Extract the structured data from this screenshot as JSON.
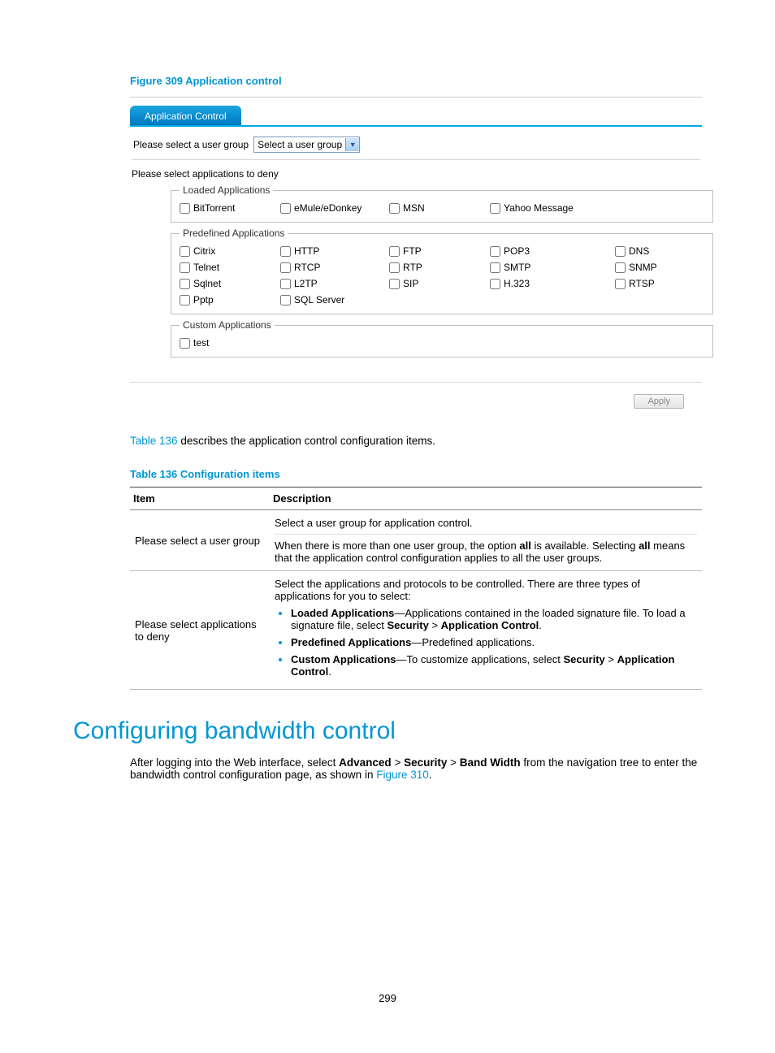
{
  "figure": {
    "caption": "Figure 309 Application control",
    "tab": "Application Control",
    "select_group_label": "Please select a user group",
    "select_group_value": "Select a user group",
    "deny_label": "Please select applications to deny",
    "fieldset_loaded": "Loaded Applications",
    "loaded": [
      "BitTorrent",
      "eMule/eDonkey",
      "MSN",
      "Yahoo Message"
    ],
    "fieldset_predefined": "Predefined Applications",
    "predefined": [
      "Citrix",
      "HTTP",
      "FTP",
      "POP3",
      "DNS",
      "Telnet",
      "RTCP",
      "RTP",
      "SMTP",
      "SNMP",
      "Sqlnet",
      "L2TP",
      "SIP",
      "H.323",
      "RTSP",
      "Pptp",
      "SQL Server"
    ],
    "fieldset_custom": "Custom Applications",
    "custom": [
      "test"
    ],
    "apply": "Apply"
  },
  "intro_before_link": "",
  "intro_link": "Table 136",
  "intro_after_link": " describes the application control configuration items.",
  "table": {
    "caption": "Table 136 Configuration items",
    "headers": [
      "Item",
      "Description"
    ],
    "row1": {
      "item": "Please select a user group",
      "desc1": "Select a user group for application control.",
      "desc2_before": "When there is more than one user group, the option ",
      "desc2_all1": "all",
      "desc2_mid": " is available. Selecting ",
      "desc2_all2": "all",
      "desc2_after": " means that the application control configuration applies to all the user groups."
    },
    "row2": {
      "item": "Please select applications to deny",
      "desc_top": "Select the applications and protocols to be controlled. There are three types of applications for you to select:",
      "li1_b": "Loaded Applications",
      "li1_rest": "—Applications contained in the loaded signature file. To load a signature file, select ",
      "li1_sec": "Security",
      "li1_gt": " > ",
      "li1_app": "Application Control",
      "li1_dot": ".",
      "li2_b": "Predefined Applications",
      "li2_rest": "—Predefined applications.",
      "li3_b": "Custom Applications",
      "li3_rest": "—To customize applications, select ",
      "li3_sec": "Security",
      "li3_gt": " > ",
      "li3_app": "Application Control",
      "li3_dot": "."
    }
  },
  "section_heading": "Configuring bandwidth control",
  "section_body": {
    "before": "After logging into the Web interface, select ",
    "adv": "Advanced",
    "gt1": " > ",
    "sec": "Security",
    "gt2": " > ",
    "bw": "Band Width",
    "mid": " from the navigation tree to enter the bandwidth control configuration page, as shown in ",
    "fig_link": "Figure 310",
    "dot": "."
  },
  "page_number": "299"
}
